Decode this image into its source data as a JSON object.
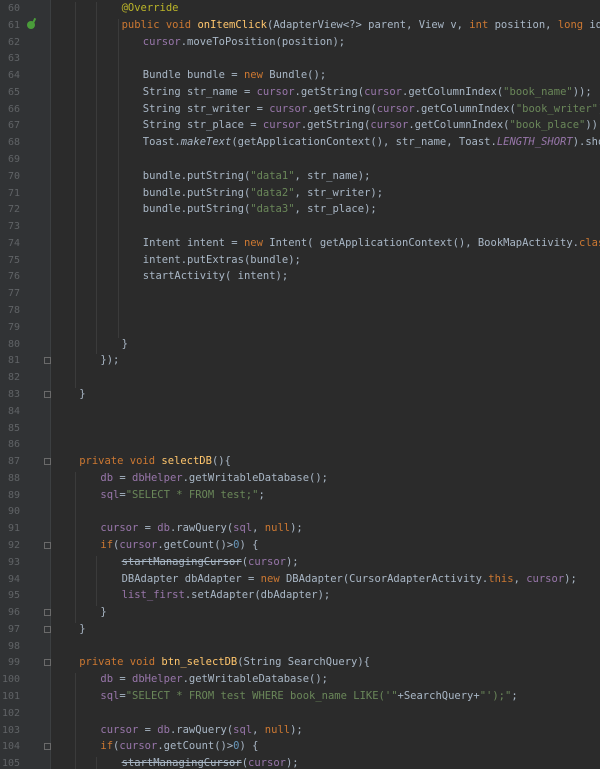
{
  "editor": {
    "lines": [
      {
        "no": "60",
        "indent": 3,
        "tokens": [
          [
            "ann",
            "@Override"
          ]
        ]
      },
      {
        "no": "61",
        "indent": 3,
        "marker": true,
        "tokens": [
          [
            "kw",
            "public void "
          ],
          [
            "fn",
            "onItemClick"
          ],
          [
            "txt",
            "(AdapterView<?> parent, View v, "
          ],
          [
            "kw",
            "int "
          ],
          [
            "txt",
            "position, "
          ],
          [
            "kw",
            "long "
          ],
          [
            "txt",
            "id) {"
          ]
        ]
      },
      {
        "no": "62",
        "indent": 4,
        "tokens": [
          [
            "field",
            "cursor"
          ],
          [
            "txt",
            ".moveToPosition(position);"
          ]
        ]
      },
      {
        "no": "63",
        "indent": 0,
        "tokens": []
      },
      {
        "no": "64",
        "indent": 4,
        "tokens": [
          [
            "txt",
            "Bundle bundle = "
          ],
          [
            "kw",
            "new "
          ],
          [
            "txt",
            "Bundle();"
          ]
        ]
      },
      {
        "no": "65",
        "indent": 4,
        "tokens": [
          [
            "txt",
            "String str_name = "
          ],
          [
            "field",
            "cursor"
          ],
          [
            "txt",
            ".getString("
          ],
          [
            "field",
            "cursor"
          ],
          [
            "txt",
            ".getColumnIndex("
          ],
          [
            "str",
            "\"book_name\""
          ],
          [
            "txt",
            "));"
          ]
        ]
      },
      {
        "no": "66",
        "indent": 4,
        "tokens": [
          [
            "txt",
            "String str_writer = "
          ],
          [
            "field",
            "cursor"
          ],
          [
            "txt",
            ".getString("
          ],
          [
            "field",
            "cursor"
          ],
          [
            "txt",
            ".getColumnIndex("
          ],
          [
            "str",
            "\"book_writer\""
          ],
          [
            "txt",
            "));"
          ]
        ]
      },
      {
        "no": "67",
        "indent": 4,
        "tokens": [
          [
            "txt",
            "String str_place = "
          ],
          [
            "field",
            "cursor"
          ],
          [
            "txt",
            ".getString("
          ],
          [
            "field",
            "cursor"
          ],
          [
            "txt",
            ".getColumnIndex("
          ],
          [
            "str",
            "\"book_place\""
          ],
          [
            "txt",
            "));"
          ]
        ]
      },
      {
        "no": "68",
        "indent": 4,
        "tokens": [
          [
            "txt",
            "Toast."
          ],
          [
            "ital",
            "makeText"
          ],
          [
            "txt",
            "(getApplicationContext(), str_name, Toast."
          ],
          [
            "ifield",
            "LENGTH_SHORT"
          ],
          [
            "txt",
            ").show();"
          ]
        ]
      },
      {
        "no": "69",
        "indent": 0,
        "tokens": []
      },
      {
        "no": "70",
        "indent": 4,
        "tokens": [
          [
            "txt",
            "bundle.putString("
          ],
          [
            "str",
            "\"data1\""
          ],
          [
            "txt",
            ", str_name);"
          ]
        ]
      },
      {
        "no": "71",
        "indent": 4,
        "tokens": [
          [
            "txt",
            "bundle.putString("
          ],
          [
            "str",
            "\"data2\""
          ],
          [
            "txt",
            ", str_writer);"
          ]
        ]
      },
      {
        "no": "72",
        "indent": 4,
        "tokens": [
          [
            "txt",
            "bundle.putString("
          ],
          [
            "str",
            "\"data3\""
          ],
          [
            "txt",
            ", str_place);"
          ]
        ]
      },
      {
        "no": "73",
        "indent": 0,
        "tokens": []
      },
      {
        "no": "74",
        "indent": 4,
        "tokens": [
          [
            "txt",
            "Intent intent = "
          ],
          [
            "kw",
            "new "
          ],
          [
            "txt",
            "Intent( getApplicationContext(), BookMapActivity."
          ],
          [
            "kw",
            "class"
          ],
          [
            "txt",
            ");"
          ]
        ]
      },
      {
        "no": "75",
        "indent": 4,
        "tokens": [
          [
            "txt",
            "intent.putExtras(bundle);"
          ]
        ]
      },
      {
        "no": "76",
        "indent": 4,
        "tokens": [
          [
            "txt",
            "startActivity( intent);"
          ]
        ]
      },
      {
        "no": "77",
        "indent": 0,
        "tokens": []
      },
      {
        "no": "78",
        "indent": 0,
        "tokens": []
      },
      {
        "no": "79",
        "indent": 0,
        "tokens": []
      },
      {
        "no": "80",
        "indent": 3,
        "tokens": [
          [
            "txt",
            "}"
          ]
        ]
      },
      {
        "no": "81",
        "indent": 2,
        "fold": true,
        "tokens": [
          [
            "txt",
            "});"
          ]
        ]
      },
      {
        "no": "82",
        "indent": 0,
        "tokens": []
      },
      {
        "no": "83",
        "indent": 1,
        "fold": true,
        "tokens": [
          [
            "txt",
            "}"
          ]
        ]
      },
      {
        "no": "84",
        "indent": 0,
        "tokens": []
      },
      {
        "no": "85",
        "indent": 0,
        "tokens": []
      },
      {
        "no": "86",
        "indent": 0,
        "tokens": []
      },
      {
        "no": "87",
        "indent": 1,
        "fold": true,
        "tokens": [
          [
            "kw",
            "private void "
          ],
          [
            "fn",
            "selectDB"
          ],
          [
            "txt",
            "(){"
          ]
        ]
      },
      {
        "no": "88",
        "indent": 2,
        "tokens": [
          [
            "field",
            "db"
          ],
          [
            "txt",
            " = "
          ],
          [
            "field",
            "dbHelper"
          ],
          [
            "txt",
            ".getWritableDatabase();"
          ]
        ]
      },
      {
        "no": "89",
        "indent": 2,
        "tokens": [
          [
            "field",
            "sql"
          ],
          [
            "txt",
            "="
          ],
          [
            "str",
            "\"SELECT * FROM test;\""
          ],
          [
            "txt",
            ";"
          ]
        ]
      },
      {
        "no": "90",
        "indent": 0,
        "tokens": []
      },
      {
        "no": "91",
        "indent": 2,
        "tokens": [
          [
            "field",
            "cursor"
          ],
          [
            "txt",
            " = "
          ],
          [
            "field",
            "db"
          ],
          [
            "txt",
            ".rawQuery("
          ],
          [
            "field",
            "sql"
          ],
          [
            "txt",
            ", "
          ],
          [
            "kw",
            "null"
          ],
          [
            "txt",
            ");"
          ]
        ]
      },
      {
        "no": "92",
        "indent": 2,
        "fold": true,
        "tokens": [
          [
            "kw",
            "if"
          ],
          [
            "txt",
            "("
          ],
          [
            "field",
            "cursor"
          ],
          [
            "txt",
            ".getCount()>"
          ],
          [
            "num",
            "0"
          ],
          [
            "txt",
            ") {"
          ]
        ]
      },
      {
        "no": "93",
        "indent": 3,
        "tokens": [
          [
            "del",
            "startManagingCursor"
          ],
          [
            "txt",
            "("
          ],
          [
            "field",
            "cursor"
          ],
          [
            "txt",
            ");"
          ]
        ]
      },
      {
        "no": "94",
        "indent": 3,
        "tokens": [
          [
            "txt",
            "DBAdapter dbAdapter = "
          ],
          [
            "kw",
            "new "
          ],
          [
            "txt",
            "DBAdapter(CursorAdapterActivity."
          ],
          [
            "kw",
            "this"
          ],
          [
            "txt",
            ", "
          ],
          [
            "field",
            "cursor"
          ],
          [
            "txt",
            ");"
          ]
        ]
      },
      {
        "no": "95",
        "indent": 3,
        "tokens": [
          [
            "field",
            "list_first"
          ],
          [
            "txt",
            ".setAdapter(dbAdapter);"
          ]
        ]
      },
      {
        "no": "96",
        "indent": 2,
        "fold": true,
        "tokens": [
          [
            "txt",
            "}"
          ]
        ]
      },
      {
        "no": "97",
        "indent": 1,
        "fold": true,
        "tokens": [
          [
            "txt",
            "}"
          ]
        ]
      },
      {
        "no": "98",
        "indent": 0,
        "tokens": []
      },
      {
        "no": "99",
        "indent": 1,
        "fold": true,
        "tokens": [
          [
            "kw",
            "private void "
          ],
          [
            "fn",
            "btn_selectDB"
          ],
          [
            "txt",
            "(String SearchQuery){"
          ]
        ]
      },
      {
        "no": "100",
        "indent": 2,
        "tokens": [
          [
            "field",
            "db"
          ],
          [
            "txt",
            " = "
          ],
          [
            "field",
            "dbHelper"
          ],
          [
            "txt",
            ".getWritableDatabase();"
          ]
        ]
      },
      {
        "no": "101",
        "indent": 2,
        "tokens": [
          [
            "field",
            "sql"
          ],
          [
            "txt",
            "="
          ],
          [
            "str",
            "\"SELECT * FROM test WHERE book_name LIKE('\""
          ],
          [
            "txt",
            "+SearchQuery+"
          ],
          [
            "str",
            "\"');\""
          ],
          [
            "txt",
            ";"
          ]
        ]
      },
      {
        "no": "102",
        "indent": 0,
        "tokens": []
      },
      {
        "no": "103",
        "indent": 2,
        "tokens": [
          [
            "field",
            "cursor"
          ],
          [
            "txt",
            " = "
          ],
          [
            "field",
            "db"
          ],
          [
            "txt",
            ".rawQuery("
          ],
          [
            "field",
            "sql"
          ],
          [
            "txt",
            ", "
          ],
          [
            "kw",
            "null"
          ],
          [
            "txt",
            ");"
          ]
        ]
      },
      {
        "no": "104",
        "indent": 2,
        "fold": true,
        "tokens": [
          [
            "kw",
            "if"
          ],
          [
            "txt",
            "("
          ],
          [
            "field",
            "cursor"
          ],
          [
            "txt",
            ".getCount()>"
          ],
          [
            "num",
            "0"
          ],
          [
            "txt",
            ") {"
          ]
        ]
      },
      {
        "no": "105",
        "indent": 3,
        "tokens": [
          [
            "del",
            "startManagingCursor"
          ],
          [
            "txt",
            "("
          ],
          [
            "field",
            "cursor"
          ],
          [
            "txt",
            ");"
          ]
        ]
      }
    ]
  }
}
